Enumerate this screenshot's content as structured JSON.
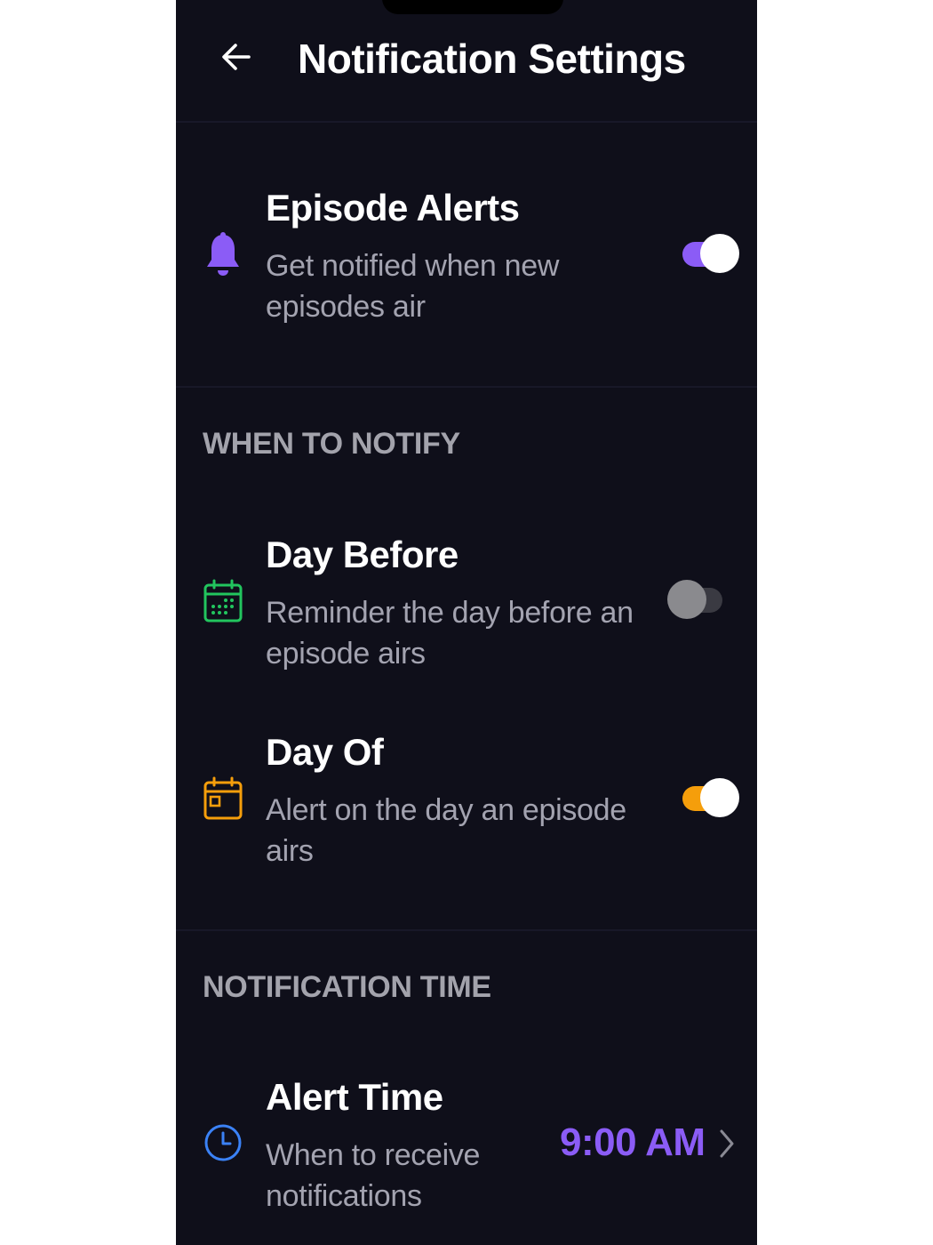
{
  "header": {
    "title": "Notification Settings",
    "back_icon": "arrow-left-icon"
  },
  "episode_alerts": {
    "title": "Episode Alerts",
    "description": "Get notified when new episodes air",
    "enabled": true,
    "icon": "bell-icon",
    "icon_color": "#8b5cf6",
    "toggle_color": "#8b5cf6"
  },
  "when_to_notify": {
    "section_title": "WHEN TO NOTIFY",
    "day_before": {
      "title": "Day Before",
      "description": "Reminder the day before an episode airs",
      "enabled": false,
      "icon": "calendar-icon",
      "icon_color": "#22c55e"
    },
    "day_of": {
      "title": "Day Of",
      "description": "Alert on the day an episode airs",
      "enabled": true,
      "icon": "calendar-day-icon",
      "icon_color": "#f59e0b",
      "toggle_color": "#f59e0b"
    }
  },
  "notification_time": {
    "section_title": "NOTIFICATION TIME",
    "alert_time": {
      "title": "Alert Time",
      "description": "When to receive notifications",
      "value": "9:00 AM",
      "value_color": "#8b5cf6",
      "icon": "clock-icon",
      "icon_color": "#3b82f6",
      "chevron_icon": "chevron-right-icon"
    }
  }
}
